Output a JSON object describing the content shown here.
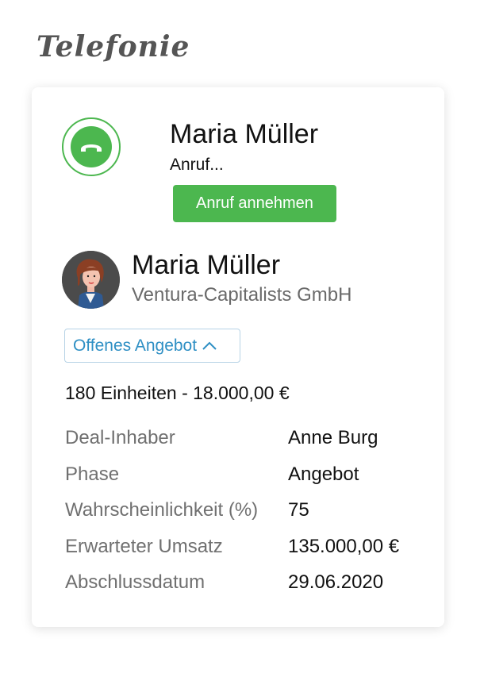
{
  "page": {
    "title": "Telefonie"
  },
  "call": {
    "caller_name": "Maria Müller",
    "status": "Anruf...",
    "accept_label": "Anruf annehmen",
    "icon": "phone-handset-icon"
  },
  "contact": {
    "name": "Maria Müller",
    "company": "Ventura-Capitalists GmbH",
    "avatar": "avatar-illustration"
  },
  "deal": {
    "badge_label": "Offenes Angebot",
    "badge_icon": "chevron-up-icon",
    "summary": "180 Einheiten - 18.000,00 €",
    "details": [
      {
        "label": "Deal-Inhaber",
        "value": "Anne Burg"
      },
      {
        "label": "Phase",
        "value": "Angebot"
      },
      {
        "label": "Wahrscheinlichkeit (%)",
        "value": "75"
      },
      {
        "label": "Erwarteter Umsatz",
        "value": "135.000,00 €"
      },
      {
        "label": "Abschlussdatum",
        "value": "29.06.2020"
      }
    ]
  },
  "colors": {
    "accent_green": "#4cb74f",
    "link_blue": "#2e8fc4",
    "muted_text": "#707070"
  }
}
